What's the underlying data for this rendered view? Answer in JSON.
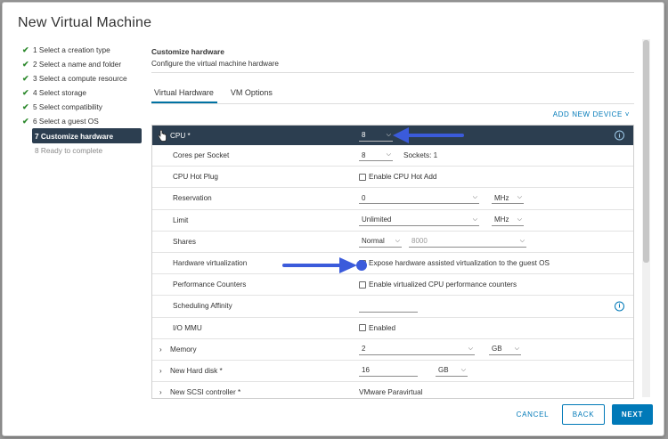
{
  "dialog": {
    "title": "New Virtual Machine"
  },
  "steps": [
    {
      "label": "1 Select a creation type",
      "state": "done"
    },
    {
      "label": "2 Select a name and folder",
      "state": "done"
    },
    {
      "label": "3 Select a compute resource",
      "state": "done"
    },
    {
      "label": "4 Select storage",
      "state": "done"
    },
    {
      "label": "5 Select compatibility",
      "state": "done"
    },
    {
      "label": "6 Select a guest OS",
      "state": "done"
    },
    {
      "label": "7 Customize hardware",
      "state": "active"
    },
    {
      "label": "8 Ready to complete",
      "state": "pending"
    }
  ],
  "content": {
    "title": "Customize hardware",
    "subtitle": "Configure the virtual machine hardware"
  },
  "tabs": [
    {
      "label": "Virtual Hardware",
      "active": true
    },
    {
      "label": "VM Options",
      "active": false
    }
  ],
  "add_device": "ADD NEW DEVICE",
  "hardware": {
    "cpu": {
      "label": "CPU *",
      "value": "8"
    },
    "cores_per_socket": {
      "label": "Cores per Socket",
      "value": "8",
      "sockets": "Sockets: 1"
    },
    "cpu_hot_plug": {
      "label": "CPU Hot Plug",
      "checkbox": "Enable CPU Hot Add"
    },
    "reservation": {
      "label": "Reservation",
      "value": "0",
      "unit": "MHz"
    },
    "limit": {
      "label": "Limit",
      "value": "Unlimited",
      "unit": "MHz"
    },
    "shares": {
      "label": "Shares",
      "value": "Normal",
      "amount": "8000"
    },
    "hw_virt": {
      "label": "Hardware virtualization",
      "checkbox": "Expose hardware assisted virtualization to the guest OS"
    },
    "perf_counters": {
      "label": "Performance Counters",
      "checkbox": "Enable virtualized CPU performance counters"
    },
    "sched_affinity": {
      "label": "Scheduling Affinity"
    },
    "io_mmu": {
      "label": "I/O MMU",
      "checkbox": "Enabled"
    },
    "memory": {
      "label": "Memory",
      "value": "2",
      "unit": "GB"
    },
    "hard_disk": {
      "label": "New Hard disk *",
      "value": "16",
      "unit": "GB"
    },
    "scsi": {
      "label": "New SCSI controller *",
      "value": "VMware Paravirtual"
    }
  },
  "footer": {
    "cancel": "CANCEL",
    "back": "BACK",
    "next": "NEXT"
  },
  "colors": {
    "accent": "#0079b8",
    "active_bg": "#2c3e50",
    "check": "#2f8a2f",
    "annotation_arrow": "#3b5bdb"
  }
}
